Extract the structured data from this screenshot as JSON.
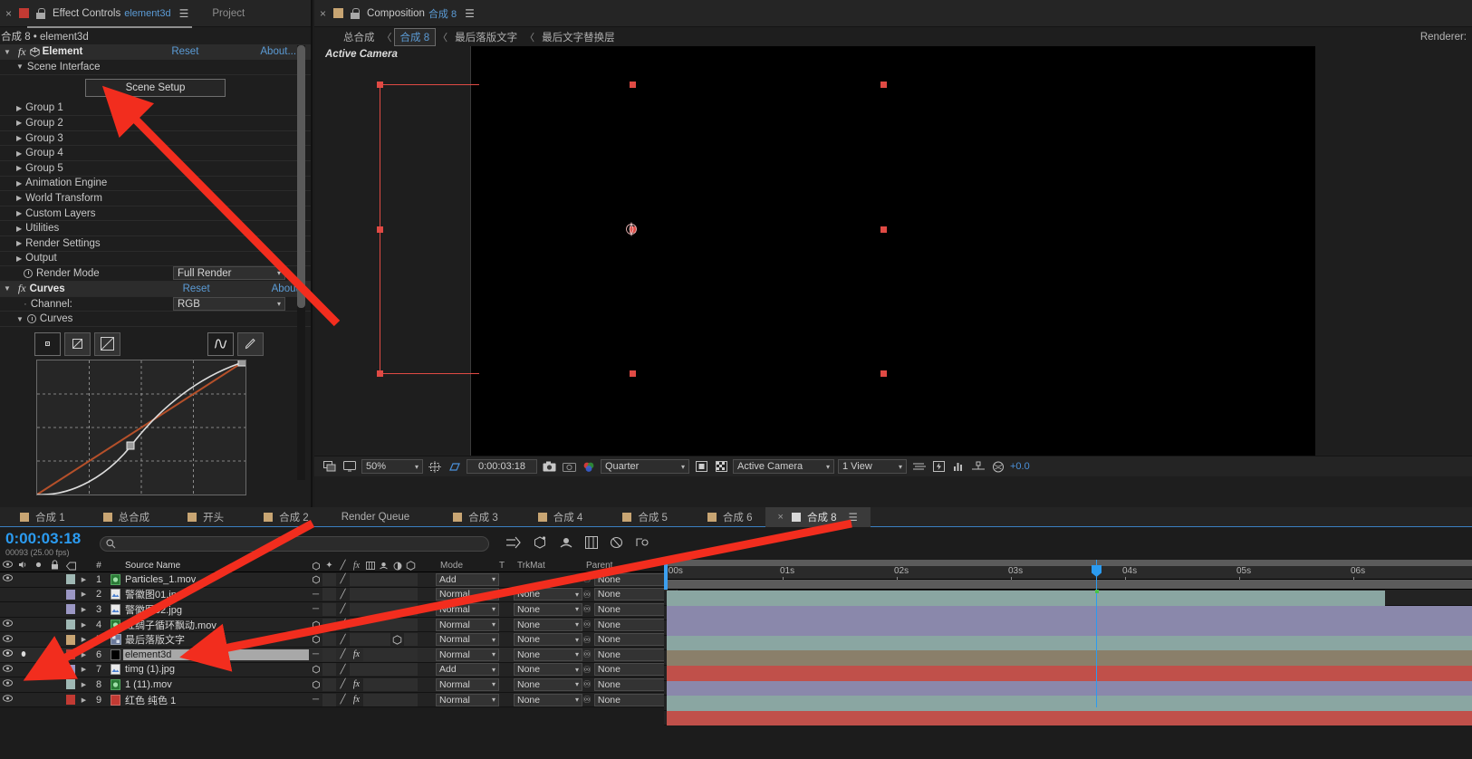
{
  "effect_controls": {
    "tab_close": "×",
    "tab_title": "Effect Controls",
    "tab_layer": "element3d",
    "tab_menu_icon": "panel-menu-icon",
    "tab_project": "Project",
    "subheader": "合成 8 • element3d",
    "effects": [
      {
        "name": "Element",
        "reset": "Reset",
        "about": "About...",
        "expanded": true
      }
    ],
    "scene_interface_label": "Scene Interface",
    "scene_setup_button": "Scene Setup",
    "groups": [
      "Group 1",
      "Group 2",
      "Group 3",
      "Group 4",
      "Group 5",
      "Animation Engine",
      "World Transform",
      "Custom Layers",
      "Utilities",
      "Render Settings",
      "Output"
    ],
    "render_mode_label": "Render Mode",
    "render_mode_value": "Full Render",
    "curves_effect": {
      "name": "Curves",
      "reset": "Reset",
      "about": "About...",
      "channel_label": "Channel:",
      "channel_value": "RGB",
      "curves_label": "Curves",
      "tools": [
        "curve-point-tool-icon",
        "curve-smooth-tool-icon",
        "curve-linear-tool-icon",
        "curve-auto-tool-icon",
        "curve-pencil-tool-icon"
      ]
    }
  },
  "composition": {
    "tab_close": "×",
    "tab_title": "Composition",
    "tab_comp_name": "合成 8",
    "tab_menu_icon": "panel-menu-icon",
    "breadcrumb": [
      {
        "label": "总合成",
        "active": false
      },
      {
        "label": "合成 8",
        "active": true
      },
      {
        "label": "最后落版文字",
        "active": false
      },
      {
        "label": "最后文字替换层",
        "active": false
      }
    ],
    "breadcrumb_separator": "〈",
    "renderer_label": "Renderer:",
    "active_camera_label": "Active Camera",
    "toolbar": {
      "zoom": "50%",
      "timecode": "0:00:03:18",
      "resolution": "Quarter",
      "view": "Active Camera",
      "view_count": "1 View",
      "exposure": "+0.0",
      "icons": [
        "toggle-transparency-grid-icon",
        "main-view-icon",
        "region-of-interest-icon",
        "grid-guides-icon",
        "snapshot-icon",
        "show-snapshot-icon",
        "channels-icon",
        "toggle-mask-icon",
        "toggle-alpha-icon",
        "timeline-flow-icon",
        "fast-preview-icon",
        "histogram-icon",
        "guides-icon",
        "exposure-reset-icon"
      ]
    }
  },
  "timeline": {
    "tabs": [
      {
        "label": "合成 1",
        "selected": false,
        "chip": "tan"
      },
      {
        "label": "总合成",
        "selected": false,
        "chip": "tan"
      },
      {
        "label": "开头",
        "selected": false,
        "chip": "tan"
      },
      {
        "label": "合成 2",
        "selected": false,
        "chip": "tan"
      },
      {
        "label": "Render Queue",
        "selected": false,
        "chip": "none"
      },
      {
        "label": "合成 3",
        "selected": false,
        "chip": "tan"
      },
      {
        "label": "合成 4",
        "selected": false,
        "chip": "tan"
      },
      {
        "label": "合成 5",
        "selected": false,
        "chip": "tan"
      },
      {
        "label": "合成 6",
        "selected": false,
        "chip": "tan"
      },
      {
        "label": "合成 8",
        "selected": true,
        "chip": "tan"
      }
    ],
    "current_time": "0:00:03:18",
    "frame_info": "00093 (25.00 fps)",
    "search_placeholder": "",
    "columns": {
      "source_name": "Source Name",
      "number": "#",
      "mode": "Mode",
      "t": "T",
      "trkmat": "TrkMat",
      "parent": "Parent"
    },
    "layers": [
      {
        "num": "1",
        "name": "Particles_1.mov",
        "mode": "Add",
        "trkmat": "",
        "parent": "None",
        "label_color": "#9fb8b4",
        "bar_color": "#8aa6a2",
        "type": "video",
        "visible": true,
        "selected": false,
        "has_fx": false,
        "bar_end_pct": 89
      },
      {
        "num": "2",
        "name": "警徽图01.jpg",
        "mode": "Normal",
        "trkmat": "None",
        "parent": "None",
        "label_color": "#9b97c4",
        "bar_color": "#8a88ab",
        "type": "image",
        "visible": false,
        "selected": false,
        "has_fx": false,
        "bar_end_pct": 100
      },
      {
        "num": "3",
        "name": "警徽图02.jpg",
        "mode": "Normal",
        "trkmat": "None",
        "parent": "None",
        "label_color": "#9b97c4",
        "bar_color": "#8a88ab",
        "type": "image",
        "visible": false,
        "selected": false,
        "has_fx": false,
        "bar_end_pct": 100
      },
      {
        "num": "4",
        "name": "红绸子循环飘动.mov",
        "mode": "Normal",
        "trkmat": "None",
        "parent": "None",
        "label_color": "#9fb8b4",
        "bar_color": "#8aa6a2",
        "type": "video",
        "visible": true,
        "selected": false,
        "has_fx": false,
        "bar_end_pct": 100
      },
      {
        "num": "5",
        "name": "最后落版文字",
        "mode": "Normal",
        "trkmat": "None",
        "parent": "None",
        "label_color": "#c8a573",
        "bar_color": "#8a7f6a",
        "type": "comp",
        "visible": true,
        "selected": false,
        "has_fx": false,
        "bar_end_pct": 100
      },
      {
        "num": "6",
        "name": "element3d",
        "mode": "Normal",
        "trkmat": "None",
        "parent": "None",
        "label_color": "#c23a33",
        "bar_color": "#c0504a",
        "type": "solid",
        "visible": true,
        "selected": true,
        "has_fx": true,
        "bar_end_pct": 100
      },
      {
        "num": "7",
        "name": "timg (1).jpg",
        "mode": "Add",
        "trkmat": "None",
        "parent": "None",
        "label_color": "#9b97c4",
        "bar_color": "#8a88ab",
        "type": "image",
        "visible": true,
        "selected": false,
        "has_fx": false,
        "bar_end_pct": 100
      },
      {
        "num": "8",
        "name": "1 (11).mov",
        "mode": "Normal",
        "trkmat": "None",
        "parent": "None",
        "label_color": "#9fb8b4",
        "bar_color": "#8aa6a2",
        "type": "video",
        "visible": true,
        "selected": false,
        "has_fx": true,
        "bar_end_pct": 100
      },
      {
        "num": "9",
        "name": "红色 纯色 1",
        "mode": "Normal",
        "trkmat": "None",
        "parent": "None",
        "label_color": "#c23a33",
        "bar_color": "#c0504a",
        "type": "solid",
        "visible": true,
        "selected": false,
        "has_fx": false,
        "bar_end_pct": 100
      }
    ],
    "ruler_ticks": [
      {
        "label": ":00s",
        "pct": 0
      },
      {
        "label": "01s",
        "pct": 14.6
      },
      {
        "label": "02s",
        "pct": 28.3
      },
      {
        "label": "03s",
        "pct": 42.5
      },
      {
        "label": "04s",
        "pct": 56.7
      },
      {
        "label": "05s",
        "pct": 71.0
      },
      {
        "label": "06s",
        "pct": 85.2
      }
    ],
    "playhead_pct": 53.4
  },
  "annotations": {
    "arrow_color": "#f22d1e",
    "arrows": [
      {
        "name": "arrow-to-scene-setup"
      },
      {
        "name": "arrow-to-layer-eye"
      },
      {
        "name": "arrow-to-element3d-layer"
      }
    ]
  }
}
